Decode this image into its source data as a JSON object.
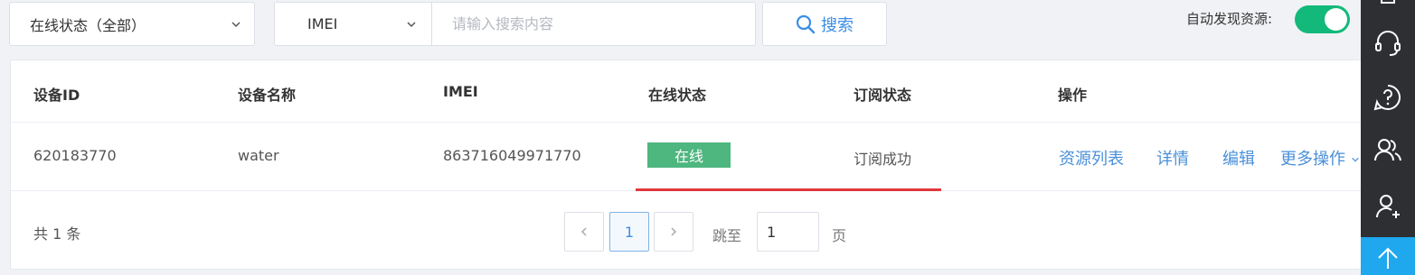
{
  "filters": {
    "status_select": "在线状态（全部）",
    "type_select": "IMEI",
    "search_placeholder": "请输入搜索内容",
    "search_button": "搜索",
    "auto_discover_label": "自动发现资源:",
    "auto_discover_on": true
  },
  "table": {
    "columns": [
      "设备ID",
      "设备名称",
      "IMEI",
      "在线状态",
      "订阅状态",
      "操作"
    ],
    "rows": [
      {
        "device_id": "620183770",
        "device_name": "water",
        "imei": "863716049971770",
        "online_status": "在线",
        "subscription": "订阅成功",
        "actions": [
          "资源列表",
          "详情",
          "编辑",
          "更多操作"
        ]
      }
    ]
  },
  "pagination": {
    "total_text": "共 1 条",
    "current_page": "1",
    "jump_label": "跳至",
    "jump_value": "1",
    "page_unit": "页"
  },
  "colors": {
    "accent": "#3a8ee6",
    "toggle_on": "#13b97a",
    "online_badge": "#4eb67f",
    "highlight_line": "#e0393e",
    "sidebar": "#2d2f33",
    "back_to_top": "#1fa8ee"
  },
  "sidebar_icons": [
    "headset-icon",
    "help-icon",
    "users-icon",
    "add-user-icon",
    "arrow-up-icon"
  ]
}
